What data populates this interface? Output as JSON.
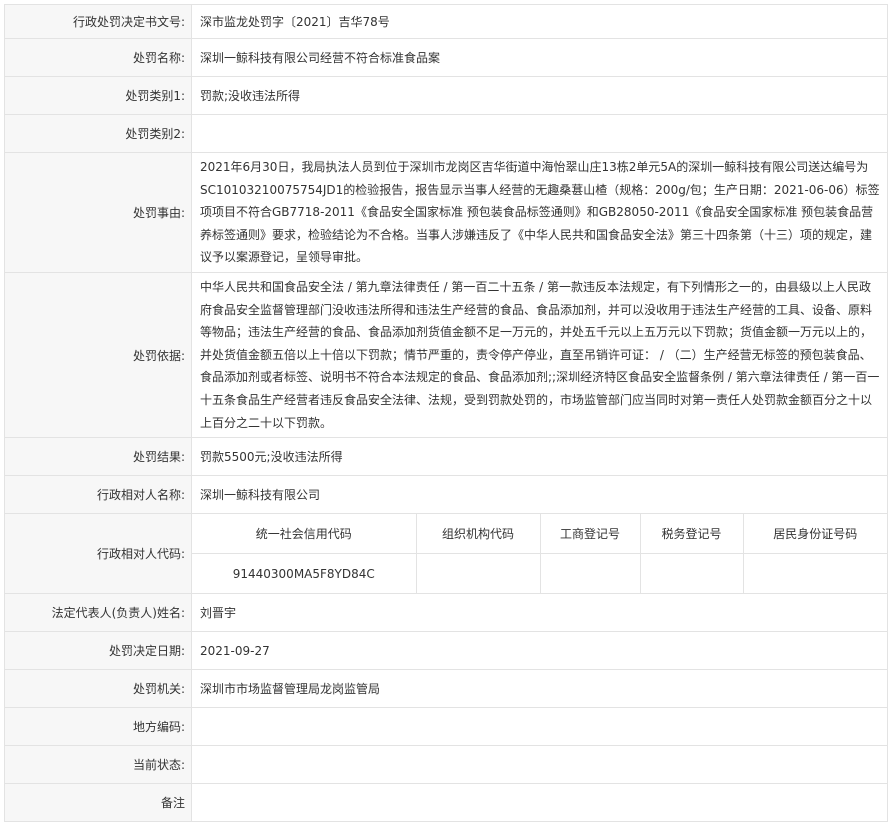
{
  "rows": {
    "doc_no": {
      "label": "行政处罚决定书文号:",
      "value": "深市监龙处罚字〔2021〕吉华78号"
    },
    "case_name": {
      "label": "处罚名称:",
      "value": "深圳一鲸科技有限公司经营不符合标准食品案"
    },
    "category1": {
      "label": "处罚类别1:",
      "value": "罚款;没收违法所得"
    },
    "category2": {
      "label": "处罚类别2:",
      "value": ""
    },
    "facts": {
      "label": "处罚事由:",
      "value": "2021年6月30日，我局执法人员到位于深圳市龙岗区吉华街道中海怡翠山庄13栋2单元5A的深圳一鲸科技有限公司送达编号为SC10103210075754JD1的检验报告，报告显示当事人经营的无趣桑葚山楂（规格：200g/包；生产日期：2021-06-06）标签项项目不符合GB7718-2011《食品安全国家标准 预包装食品标签通则》和GB28050-2011《食品安全国家标准 预包装食品营养标签通则》要求，检验结论为不合格。当事人涉嫌违反了《中华人民共和国食品安全法》第三十四条第（十三）项的规定，建议予以案源登记，呈领导审批。"
    },
    "basis": {
      "label": "处罚依据:",
      "value": "中华人民共和国食品安全法 / 第九章法律责任 / 第一百二十五条 / 第一款违反本法规定，有下列情形之一的，由县级以上人民政府食品安全监督管理部门没收违法所得和违法生产经营的食品、食品添加剂，并可以没收用于违法生产经营的工具、设备、原料等物品；违法生产经营的食品、食品添加剂货值金额不足一万元的，并处五千元以上五万元以下罚款；货值金额一万元以上的，并处货值金额五倍以上十倍以下罚款；情节严重的，责令停产停业，直至吊销许可证： / （二）生产经营无标签的预包装食品、食品添加剂或者标签、说明书不符合本法规定的食品、食品添加剂;;深圳经济特区食品安全监督条例 / 第六章法律责任 / 第一百一十五条食品生产经营者违反食品安全法律、法规，受到罚款处罚的，市场监管部门应当同时对第一责任人处罚款金额百分之十以上百分之二十以下罚款。"
    },
    "result": {
      "label": "处罚结果:",
      "value": "罚款5500元;没收违法所得"
    },
    "party_name": {
      "label": "行政相对人名称:",
      "value": "深圳一鲸科技有限公司"
    },
    "party_code": {
      "label": "行政相对人代码:",
      "headers": [
        "统一社会信用代码",
        "组织机构代码",
        "工商登记号",
        "税务登记号",
        "居民身份证号码"
      ],
      "values": [
        "91440300MA5F8YD84C",
        "",
        "",
        "",
        ""
      ]
    },
    "legal_rep": {
      "label": "法定代表人(负责人)姓名:",
      "value": "刘晋宇"
    },
    "date": {
      "label": "处罚决定日期:",
      "value": "2021-09-27"
    },
    "authority": {
      "label": "处罚机关:",
      "value": "深圳市市场监督管理局龙岗监管局"
    },
    "region_code": {
      "label": "地方编码:",
      "value": ""
    },
    "status": {
      "label": "当前状态:",
      "value": ""
    },
    "remarks": {
      "label": "备注",
      "value": ""
    }
  }
}
